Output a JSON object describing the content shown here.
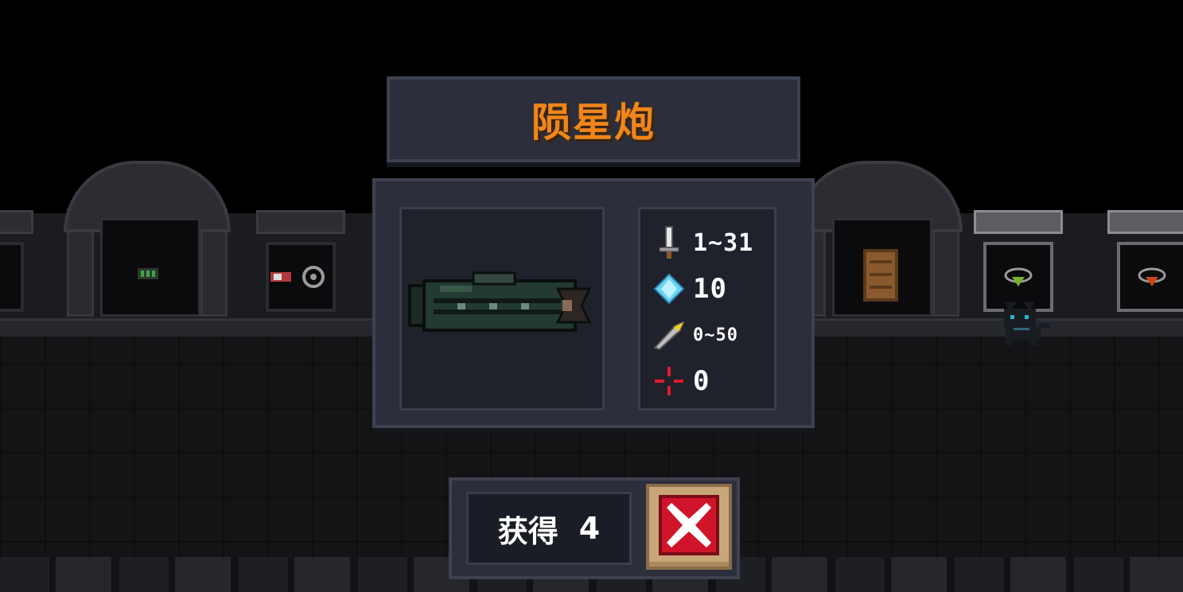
{
  "weapon": {
    "name": "陨星炮",
    "sprite": "meteor-cannon-sprite"
  },
  "stats": [
    {
      "icon": "sword-icon",
      "label_name": "damage",
      "value": "1~31"
    },
    {
      "icon": "energy-crystal-icon",
      "label_name": "energy-cost",
      "value": "10"
    },
    {
      "icon": "critical-feather-icon",
      "label_name": "critical-chance",
      "value": "0~50"
    },
    {
      "icon": "accuracy-crosshair-icon",
      "label_name": "inaccuracy",
      "value": "0"
    }
  ],
  "acquire": {
    "label": "获得",
    "count": "4"
  },
  "close_button": {
    "icon": "close-x-icon"
  },
  "colors": {
    "weapon_name": "#f0861a",
    "panel_bg": "#2c2f3b",
    "close_red": "#d0142a",
    "close_frame": "#c9a679"
  }
}
